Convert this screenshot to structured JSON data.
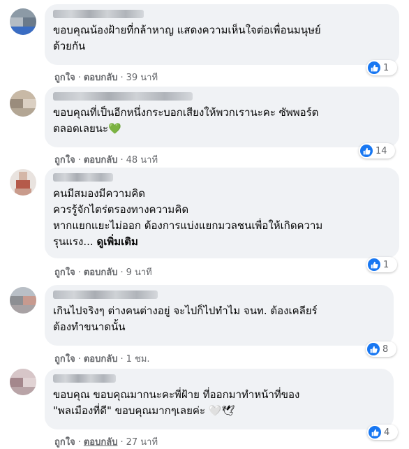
{
  "comments": [
    {
      "text": "ขอบคุณน้องฝ้ายที่กล้าหาญ แสดงความเห็นใจต่อเพื่อนมนุษย์\nด้วยกัน",
      "like_label": "ถูกใจ",
      "reply_label": "ตอบกลับ",
      "time": "39 นาที",
      "reactions": "1"
    },
    {
      "text": "ขอบคุณที่เป็นอีกหนึ่งกระบอกเสียงให้พวกเรานะคะ ซัพพอร์ต\nตลอดเลยนะ",
      "emoji": "💚",
      "like_label": "ถูกใจ",
      "reply_label": "ตอบกลับ",
      "time": "48 นาที",
      "reactions": "14"
    },
    {
      "text": "คนมีสมองมีความคิด\nควรรู้จักไตร่ตรองทางความคิด\nหากแยกแยะไม่ออก ต้องการแบ่งแยกมวลชนเพื่อให้เกิดความ\nรุนแรง...",
      "see_more": "ดูเพิ่มเติม",
      "like_label": "ถูกใจ",
      "reply_label": "ตอบกลับ",
      "time": "9 นาที",
      "reactions": "1"
    },
    {
      "text": "เกินไปจริงๆ ต่างคนต่างอยู่ จะไปก็ไปทำไม จนท. ต้องเคลียร์\nต้องทำขนาดนั้น",
      "like_label": "ถูกใจ",
      "reply_label": "ตอบกลับ",
      "time": "1 ชม.",
      "reactions": "8"
    },
    {
      "text": "ขอบคุณ ขอบคุณมากนะคะพี่ฝ้าย ที่ออกมาทำหน้าที่ของ\n\"พลเมืองที่ดี\" ขอบคุณมากๆเลยค่ะ",
      "emoji": "🤍🕊",
      "like_label": "ถูกใจ",
      "reply_label": "ตอบกลับ",
      "time": "27 นาที",
      "reactions": "4"
    }
  ],
  "separator": "·",
  "colors": {
    "bubble": "#f0f2f5",
    "like_blue": "#1877f2",
    "meta_gray": "#65676b",
    "heart_green": "#2fb34a"
  },
  "icons": {
    "reaction": "thumbs-up-icon"
  }
}
